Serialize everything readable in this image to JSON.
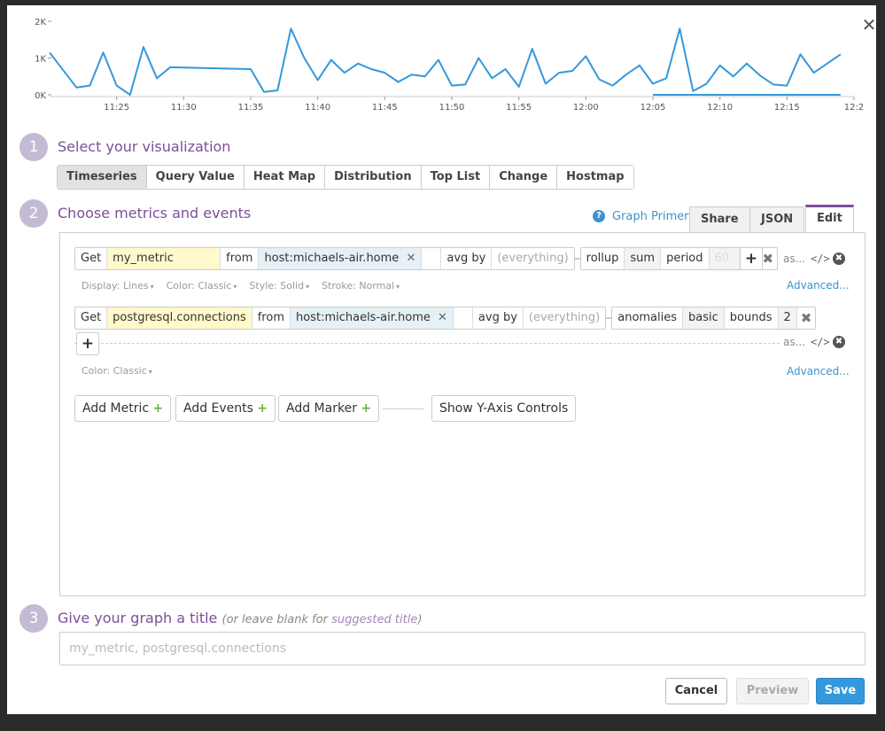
{
  "dialog": {
    "close_glyph": "✕"
  },
  "chart_data": {
    "type": "line",
    "ylim": [
      0,
      2000
    ],
    "yticks": [
      "0K",
      "1K",
      "2K"
    ],
    "xticks": [
      "11:25",
      "11:30",
      "11:35",
      "11:40",
      "11:45",
      "11:50",
      "11:55",
      "12:00",
      "12:05",
      "12:10",
      "12:15",
      "12:2"
    ],
    "series": [
      {
        "color": "#3498db",
        "x": [
          "11:20",
          "11:22",
          "11:23",
          "11:24",
          "11:25",
          "11:26",
          "11:27",
          "11:28",
          "11:29",
          "11:35",
          "11:36",
          "11:37",
          "11:38",
          "11:39",
          "11:40",
          "11:41",
          "11:42",
          "11:43",
          "11:44",
          "11:45",
          "11:46",
          "11:47",
          "11:48",
          "11:49",
          "11:50",
          "11:51",
          "11:52",
          "11:53",
          "11:54",
          "11:55",
          "11:56",
          "11:57",
          "11:58",
          "11:59",
          "12:00",
          "12:01",
          "12:02",
          "12:03",
          "12:04",
          "12:05",
          "12:06",
          "12:07",
          "12:08",
          "12:09",
          "12:10",
          "12:11",
          "12:12",
          "12:13",
          "12:14",
          "12:15",
          "12:16",
          "12:17",
          "12:19"
        ],
        "y": [
          1150,
          200,
          250,
          1150,
          250,
          0,
          1300,
          450,
          750,
          700,
          80,
          120,
          1800,
          1000,
          400,
          950,
          600,
          850,
          700,
          600,
          350,
          550,
          500,
          950,
          250,
          280,
          1000,
          450,
          700,
          220,
          1250,
          300,
          600,
          650,
          1050,
          420,
          250,
          550,
          800,
          300,
          450,
          1800,
          100,
          300,
          800,
          500,
          850,
          520,
          280,
          250,
          1100,
          600,
          1100
        ]
      },
      {
        "color": "#3498db",
        "x": [
          "12:05",
          "12:19"
        ],
        "y": [
          0,
          0
        ]
      }
    ]
  },
  "steps": [
    {
      "num": "1",
      "title": "Select your visualization"
    },
    {
      "num": "2",
      "title": "Choose metrics and events"
    },
    {
      "num": "3",
      "title": "Give your graph a title",
      "hint": "(or leave blank for ",
      "hint_link": "suggested title",
      "hint_end": ")"
    }
  ],
  "viz_tabs": [
    "Timeseries",
    "Query Value",
    "Heat Map",
    "Distribution",
    "Top List",
    "Change",
    "Hostmap"
  ],
  "graph_primer": {
    "help_glyph": "?",
    "label": "Graph Primer"
  },
  "editor_tabs": [
    "Share",
    "JSON",
    "Edit"
  ],
  "query1": {
    "get": "Get",
    "metric": "my_metric",
    "from": "from",
    "host": "host:michaels-air.home",
    "x": "✕",
    "avg_by": "avg by",
    "everything": "(everything)",
    "rollup": "rollup",
    "sum": "sum",
    "period": "period",
    "period_value": "60",
    "remove": "✖",
    "add": "+",
    "as": "as...",
    "code": "</>",
    "delete": "✖",
    "options": [
      {
        "label": "Display:",
        "value": "Lines"
      },
      {
        "label": "Color:",
        "value": "Classic"
      },
      {
        "label": "Style:",
        "value": "Solid"
      },
      {
        "label": "Stroke:",
        "value": "Normal"
      }
    ],
    "caret": "▾",
    "advanced": "Advanced..."
  },
  "query2": {
    "get": "Get",
    "metric": "postgresql.connections",
    "from": "from",
    "host": "host:michaels-air.home",
    "x": "✕",
    "avg_by": "avg by",
    "everything": "(everything)",
    "anomalies": "anomalies",
    "basic": "basic",
    "bounds": "bounds",
    "bounds_value": "2",
    "remove": "✖",
    "add": "+",
    "as": "as...",
    "code": "</>",
    "delete": "✖",
    "options": [
      {
        "label": "Color:",
        "value": "Classic"
      }
    ],
    "caret": "▾",
    "advanced": "Advanced..."
  },
  "add_buttons": {
    "metric": "Add Metric",
    "events": "Add Events",
    "marker": "Add Marker",
    "plus": "+",
    "y_axis": "Show Y-Axis Controls"
  },
  "title_input": {
    "placeholder": "my_metric, postgresql.connections",
    "value": ""
  },
  "footer": {
    "cancel": "Cancel",
    "preview": "Preview",
    "save": "Save"
  },
  "colors": {
    "accent": "#7d4e9c",
    "link": "#3b93cf",
    "save": "#3498db",
    "series": "#3498db"
  }
}
